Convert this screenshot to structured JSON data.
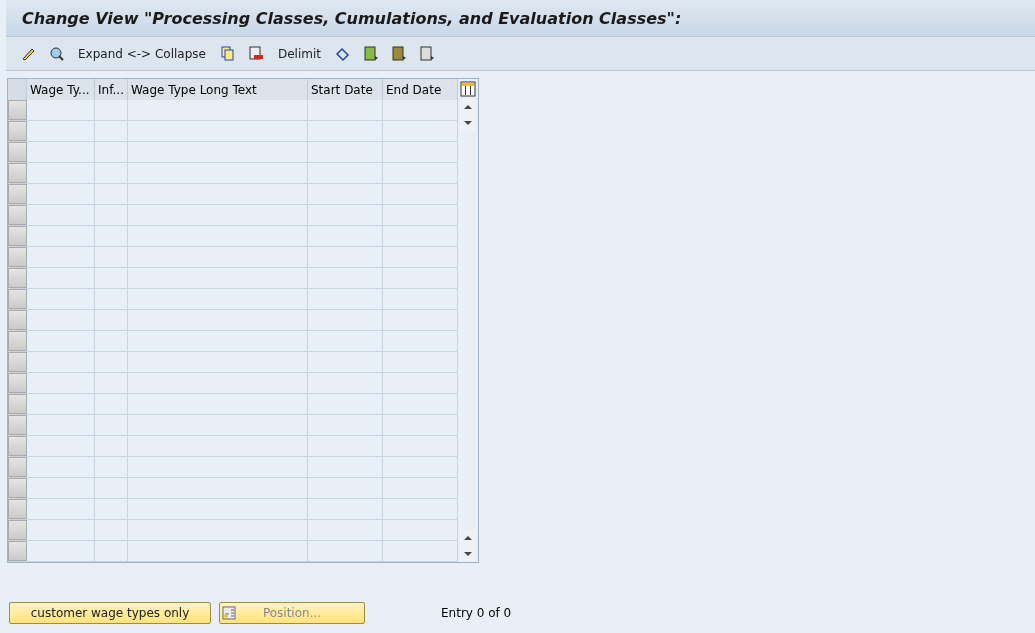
{
  "window": {
    "title": "Change View \"Processing Classes, Cumulations, and Evaluation Classes\":"
  },
  "toolbar": [
    {
      "kind": "icon"
    },
    {
      "kind": "icon"
    },
    {
      "kind": "text",
      "label": "Expand <-> Collapse"
    },
    {
      "kind": "icon"
    },
    {
      "kind": "icon"
    },
    {
      "kind": "text",
      "label": "Delimit"
    },
    {
      "kind": "icon"
    },
    {
      "kind": "icon"
    },
    {
      "kind": "icon"
    },
    {
      "kind": "icon"
    }
  ],
  "table": {
    "columns": [
      "Wage Ty...",
      "Inf...",
      "Wage Type Long Text",
      "Start Date",
      "End Date"
    ]
  },
  "footer": {
    "buttons": [
      {
        "label": "customer wage types only",
        "disabled": false
      },
      {
        "label": "Position...",
        "disabled": true
      }
    ],
    "entry": "Entry 0 of 0"
  }
}
